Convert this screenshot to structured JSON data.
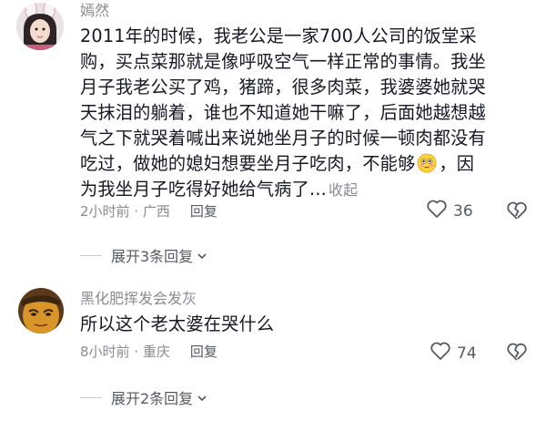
{
  "comments": [
    {
      "username": "嫣然",
      "lines": [
        "2011年的时候，我老公是一家700人公司的饭堂采",
        "购，买点菜那就是像呼吸空气一样正常的事情。我坐",
        "月子我老公买了鸡，猪蹄，很多肉菜，我婆婆她就哭",
        "天抹泪的躺着，谁也不知道她干嘛了，后面她越想越",
        "气之下就哭着喊出来说她坐月子的时候一顿肉都没有"
      ],
      "line6_before_emoji": "吃过，做她的媳妇想要坐月子吃肉，不能够",
      "line6_after_emoji": "，因",
      "line7": "为我坐月子吃得好她给气病了...",
      "collapse_label": "收起",
      "emoji_icon": "flushed-face",
      "time": "2小时前",
      "location": "广西",
      "reply_label": "回复",
      "likes": "36",
      "expand_label": "展开3条回复"
    },
    {
      "username": "黑化肥挥发会发灰",
      "text": "所以这个老太婆在哭什么",
      "time": "8小时前",
      "location": "重庆",
      "reply_label": "回复",
      "likes": "74",
      "expand_label": "展开2条回复"
    }
  ],
  "separator": " · ",
  "colors": {
    "meta": "#8a8b91",
    "text": "#161823",
    "icon": "#555a61"
  }
}
